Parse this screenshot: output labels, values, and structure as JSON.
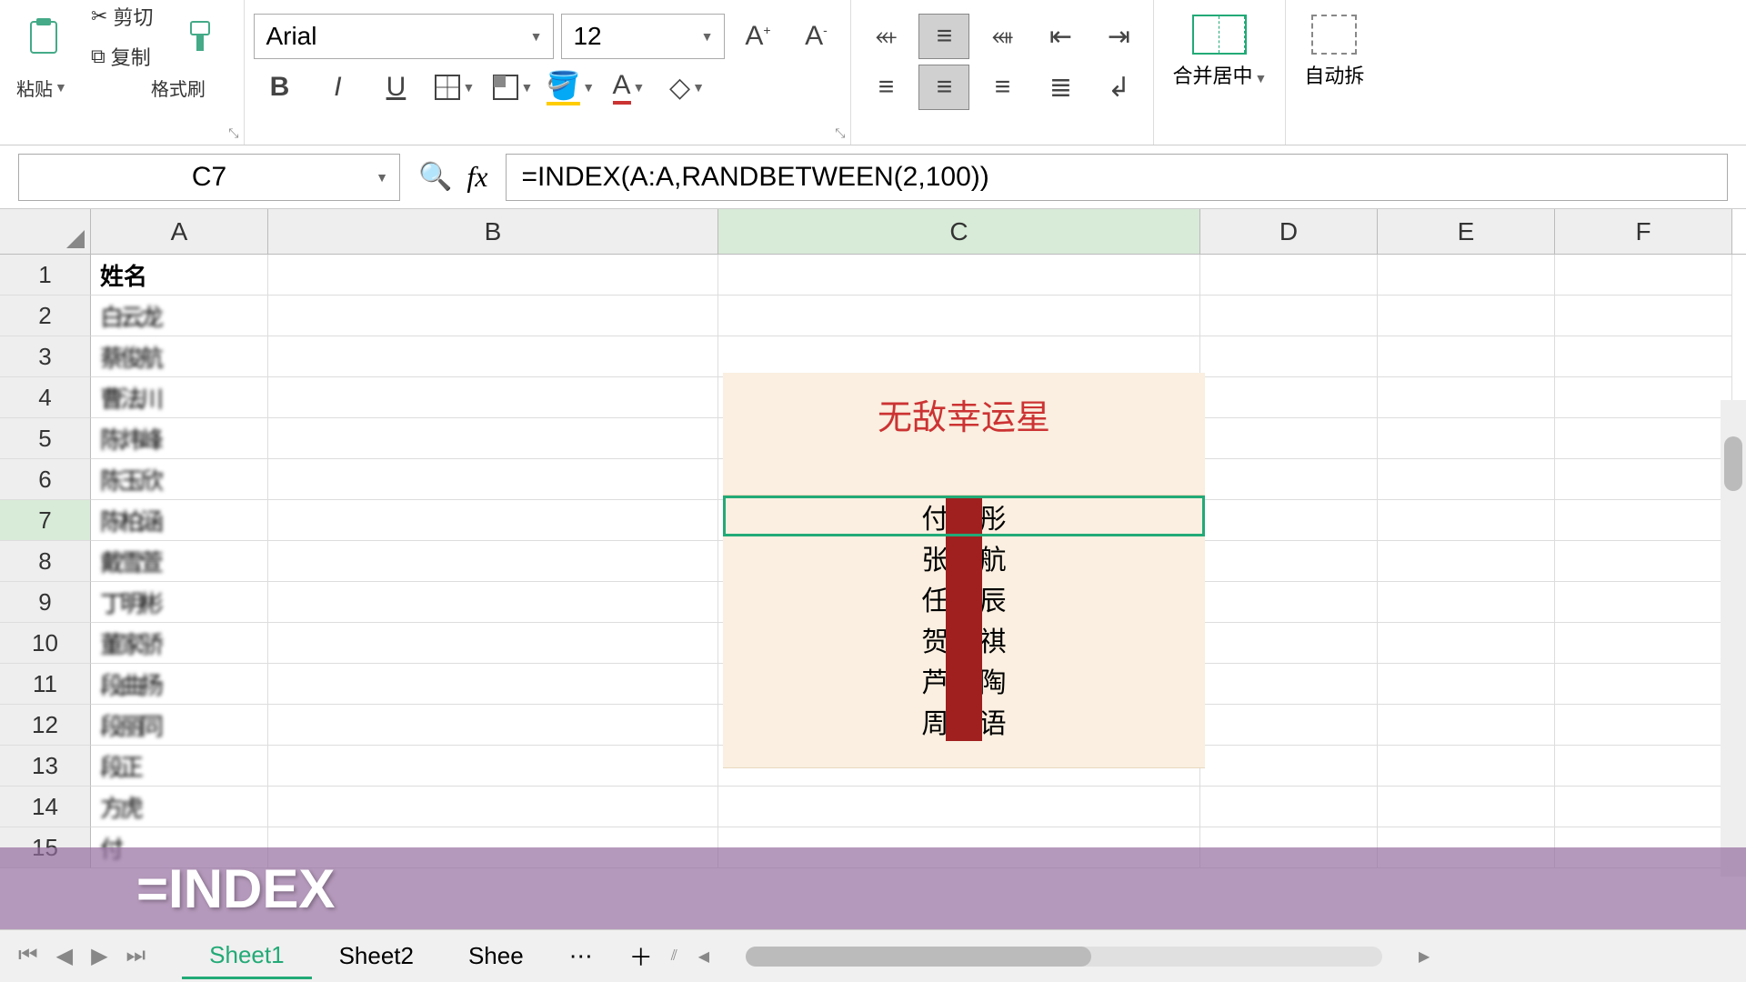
{
  "toolbar": {
    "paste": "粘贴",
    "cut": "剪切",
    "copy": "复制",
    "format_painter": "格式刷",
    "font_name": "Arial",
    "font_size": "12",
    "merge_center": "合并居中",
    "auto_wrap": "自动拆"
  },
  "formula_bar": {
    "cell_ref": "C7",
    "formula": "=INDEX(A:A,RANDBETWEEN(2,100))"
  },
  "columns": [
    "A",
    "B",
    "C",
    "D",
    "E",
    "F"
  ],
  "rows_visible": 15,
  "data": {
    "A1": "姓名",
    "A2": "白云龙",
    "A3": "蔡俊航",
    "A4": "曹法川",
    "A5": "陈炜峰",
    "A6": "陈玉欣",
    "A7": "陈柏涵",
    "A8": "戴雪萱",
    "A9": "丁明彬",
    "A10": "董家骄",
    "A11": "段曲扬",
    "A12": "段丽同",
    "A13": "段正",
    "A14": "方虎",
    "A15": "付"
  },
  "lottery": {
    "title": "无敌幸运星",
    "results": [
      {
        "left": "付",
        "right": "彤"
      },
      {
        "left": "张",
        "right": "航"
      },
      {
        "left": "任",
        "right": "辰"
      },
      {
        "left": "贺",
        "right": "祺"
      },
      {
        "left": "芦",
        "right": "陶"
      },
      {
        "left": "周",
        "right": "语"
      }
    ]
  },
  "overlay_text": "=INDEX",
  "tabs": {
    "t1": "Sheet1",
    "t2": "Sheet2",
    "t3": "Shee"
  },
  "chart_data": null
}
